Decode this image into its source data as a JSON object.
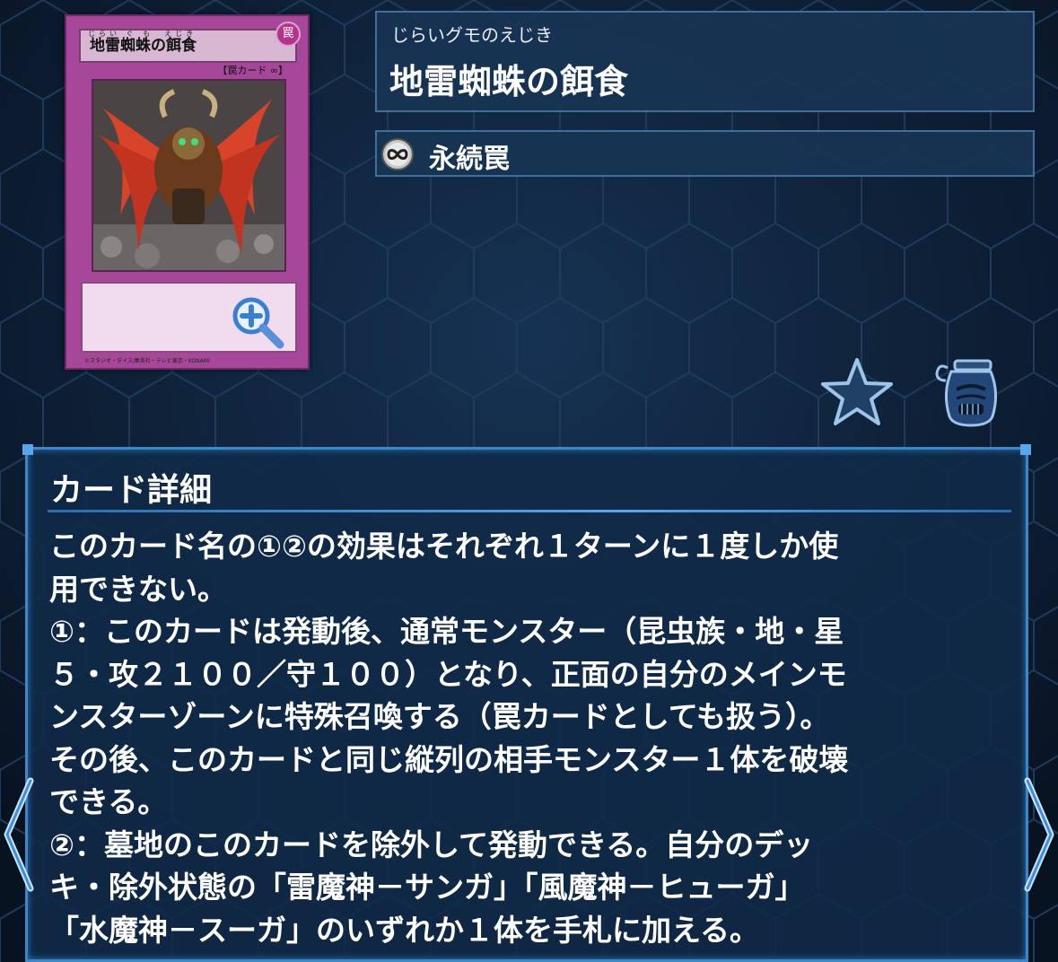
{
  "card": {
    "name": "地雷蜘蛛の餌食",
    "ruby": "じらい ぐ も　えじき",
    "attribute_symbol": "罠",
    "type_line": "【罠カード ∞】",
    "copyright": "©スタジオ・ダイス/集英社・テレビ東京・KONAMI"
  },
  "header": {
    "reading": "じらいグモのえじき",
    "name": "地雷蜘蛛の餌食"
  },
  "type": {
    "icon": "infinity-icon",
    "label": "永続罠"
  },
  "actions": {
    "favorite_icon": "star-icon",
    "pot_icon": "pot-of-greed-icon",
    "zoom_icon": "magnify-icon"
  },
  "detail": {
    "title": "カード詳細",
    "body": "このカード名の①②の効果はそれぞれ１ターンに１度しか使\n用できない。\n①：このカードは発動後、通常モンスター（昆虫族・地・星\n５・攻２１００／守１００）となり、正面の自分のメインモ\nンスターゾーンに特殊召喚する（罠カードとしても扱う）。\nその後、このカードと同じ縦列の相手モンスター１体を破壊\nできる。\n②：墓地のこのカードを除外して発動できる。自分のデッ\nキ・除外状態の「雷魔神－サンガ」「風魔神－ヒューガ」\n「水魔神－スーガ」のいずれか１体を手札に加える。"
  },
  "colors": {
    "background": "#0c1a2c",
    "panel": "#183454",
    "panel_border": "#3f6f9a",
    "accent": "#5aa6ea",
    "trap_card": "#a6479a"
  }
}
